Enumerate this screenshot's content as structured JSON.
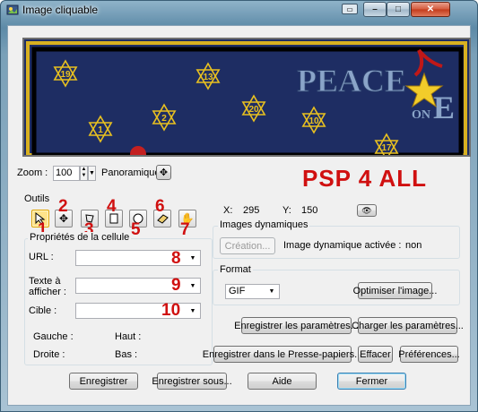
{
  "window": {
    "title": "Image cliquable",
    "min_glyph": "–",
    "max_glyph": "□",
    "close_glyph": "✕"
  },
  "preview": {
    "banner_text": "PEACE",
    "banner_text_on": "ON",
    "banner_text_e": "E",
    "stars": [
      "19",
      "13",
      "2",
      "20",
      "10",
      "1",
      "17"
    ]
  },
  "zoom": {
    "label": "Zoom :",
    "value": "100",
    "panoramique_label": "Panoramique"
  },
  "watermark": "PSP 4 ALL",
  "tools": {
    "label": "Outils",
    "numbers": [
      "1",
      "2",
      "3",
      "4",
      "5",
      "6",
      "7"
    ]
  },
  "coords": {
    "x_label": "X:",
    "x_value": "295",
    "y_label": "Y:",
    "y_value": "150"
  },
  "cell_props": {
    "title": "Propriétés de la cellule",
    "url_label": "URL :",
    "alt_label_1": "Texte à",
    "alt_label_2": "afficher :",
    "target_label": "Cible :",
    "url_num": "8",
    "alt_num": "9",
    "target_num": "10",
    "gauche_label": "Gauche :",
    "haut_label": "Haut :",
    "droite_label": "Droite :",
    "bas_label": "Bas :"
  },
  "dynamic": {
    "title": "Images dynamiques",
    "creation_label": "Création...",
    "active_label": "Image dynamique activée :",
    "active_value": "non"
  },
  "format": {
    "title": "Format",
    "selected": "GIF",
    "optimize_label": "Optimiser l'image..."
  },
  "actions": {
    "save_params": "Enregistrer les paramètres...",
    "load_params": "Charger les paramètres...",
    "save_clipboard": "Enregistrer dans le Presse-papiers...",
    "clear": "Effacer",
    "preferences": "Préférences..."
  },
  "footer": {
    "save": "Enregistrer",
    "save_as": "Enregistrer sous...",
    "help": "Aide",
    "close": "Fermer"
  },
  "colors": {
    "accent_red": "#d01010",
    "preview_bg": "#1a2a5c",
    "star": "#e8c020"
  }
}
